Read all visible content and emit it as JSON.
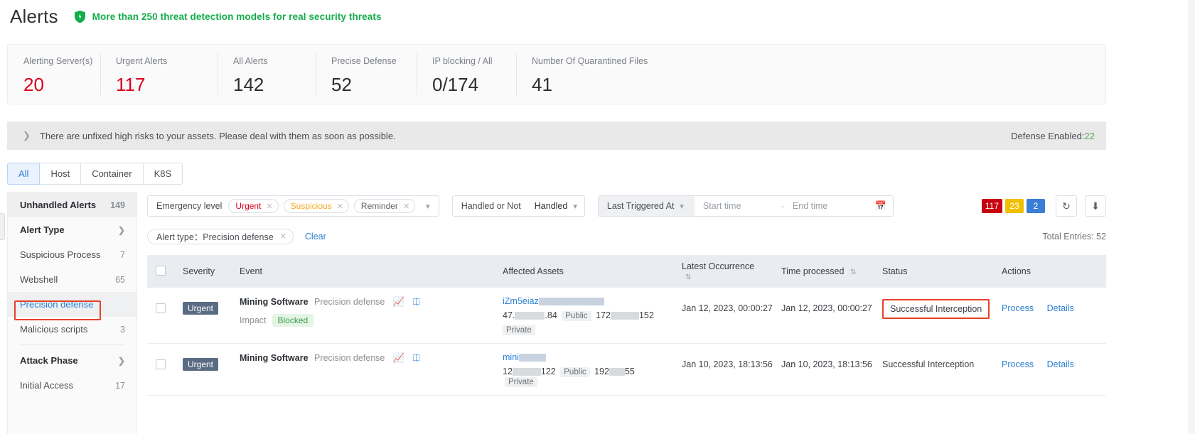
{
  "header": {
    "title": "Alerts",
    "shield_icon": "shield-icon",
    "tagline": "More than 250 threat detection models for real security threats",
    "tagline_color": "#13ad4a"
  },
  "stats": [
    {
      "label": "Alerting Server(s)",
      "value": "20",
      "color": "red"
    },
    {
      "label": "Urgent Alerts",
      "value": "117",
      "color": "red"
    },
    {
      "label": "All Alerts",
      "value": "142",
      "color": "dark"
    },
    {
      "label": "Precise Defense",
      "value": "52",
      "color": "dark"
    },
    {
      "label": "IP blocking / All",
      "value": "0/174",
      "color": "dark"
    },
    {
      "label": "Number Of Quarantined Files",
      "value": "41",
      "color": "dark"
    }
  ],
  "warning": {
    "chevron_icon": "chevron-right-icon",
    "text": "There are unfixed high risks to your assets. Please deal with them as soon as possible.",
    "right_label": "Defense Enabled:",
    "right_value": "22"
  },
  "tabs": [
    {
      "label": "All",
      "active": true
    },
    {
      "label": "Host",
      "active": false
    },
    {
      "label": "Container",
      "active": false
    },
    {
      "label": "K8S",
      "active": false
    }
  ],
  "sidebar": {
    "unhandled": {
      "label": "Unhandled Alerts",
      "count": "149"
    },
    "groups": [
      {
        "title": "Alert Type",
        "chevron_icon": "chevron-right-icon",
        "items": [
          {
            "label": "Suspicious Process",
            "count": "7",
            "selected": false
          },
          {
            "label": "Webshell",
            "count": "65",
            "selected": false
          },
          {
            "label": "Precision defense",
            "count": "",
            "selected": true
          },
          {
            "label": "Malicious scripts",
            "count": "3",
            "selected": false
          }
        ]
      },
      {
        "title": "Attack Phase",
        "chevron_icon": "chevron-right-icon",
        "items": [
          {
            "label": "Initial Access",
            "count": "17",
            "selected": false
          }
        ]
      }
    ]
  },
  "filters": {
    "emergency": {
      "label": "Emergency level",
      "chips": [
        {
          "label": "Urgent",
          "tone": "urgent",
          "close_icon": "close-icon"
        },
        {
          "label": "Suspicious",
          "tone": "suspicious",
          "close_icon": "close-icon"
        },
        {
          "label": "Reminder",
          "tone": "reminder",
          "close_icon": "close-icon"
        }
      ],
      "caret_icon": "chevron-down-icon"
    },
    "handled": {
      "label": "Handled or Not",
      "value": "Handled",
      "caret_icon": "chevron-down-icon"
    },
    "date": {
      "selector": "Last Triggered At",
      "caret_icon": "chevron-down-icon",
      "start_placeholder": "Start time",
      "start_value": "",
      "separator": "-",
      "end_placeholder": "End time",
      "end_value": "",
      "calendar_icon": "calendar-icon"
    },
    "badges": [
      {
        "value": "117",
        "color": "#c8000f"
      },
      {
        "value": "23",
        "color": "#f0c000"
      },
      {
        "value": "2",
        "color": "#3a7fd5"
      }
    ],
    "refresh_icon": "refresh-icon",
    "download_icon": "download-icon"
  },
  "applied": {
    "chip": "Alert type：Precision defense",
    "chip_close_icon": "close-icon",
    "clear_label": "Clear",
    "total_entries": "Total Entries: 52"
  },
  "table": {
    "columns": [
      {
        "label": "",
        "key": "checkbox"
      },
      {
        "label": "Severity",
        "key": "severity"
      },
      {
        "label": "Event",
        "key": "event"
      },
      {
        "label": "Affected Assets",
        "key": "assets"
      },
      {
        "label": "Latest Occurrence",
        "key": "latest",
        "sort_icon": "sort-icon"
      },
      {
        "label": "Time processed",
        "key": "processed",
        "sort_icon": "sort-icon"
      },
      {
        "label": "Status",
        "key": "status"
      },
      {
        "label": "Actions",
        "key": "actions"
      }
    ],
    "rows": [
      {
        "severity": "Urgent",
        "event_name": "Mining Software",
        "event_type": "Precision defense",
        "event_icons": [
          "chart-icon",
          "search-chart-icon"
        ],
        "impact_label": "Impact",
        "impact_value": "Blocked",
        "asset_host": "iZm5eiaz",
        "asset_ip1": "47.",
        "asset_ip1b": ".84",
        "asset_tag1": "Public",
        "asset_ip2": "172",
        "asset_ip2b": "152",
        "asset_tag2": "Private",
        "latest": "Jan 12, 2023, 00:00:27",
        "processed": "Jan 12, 2023, 00:00:27",
        "status": "Successful Interception",
        "status_highlight": true,
        "action_process": "Process",
        "action_details": "Details"
      },
      {
        "severity": "Urgent",
        "event_name": "Mining Software",
        "event_type": "Precision defense",
        "event_icons": [
          "chart-icon",
          "search-chart-icon"
        ],
        "impact_label": "",
        "impact_value": "",
        "asset_host": "mini",
        "asset_ip1": "12",
        "asset_ip1b": "122",
        "asset_tag1": "Public",
        "asset_ip2": "192",
        "asset_ip2b": "55",
        "asset_tag2": "Private",
        "latest": "Jan 10, 2023, 18:13:56",
        "processed": "Jan 10, 2023, 18:13:56",
        "status": "Successful Interception",
        "status_highlight": false,
        "action_process": "Process",
        "action_details": "Details"
      }
    ]
  }
}
